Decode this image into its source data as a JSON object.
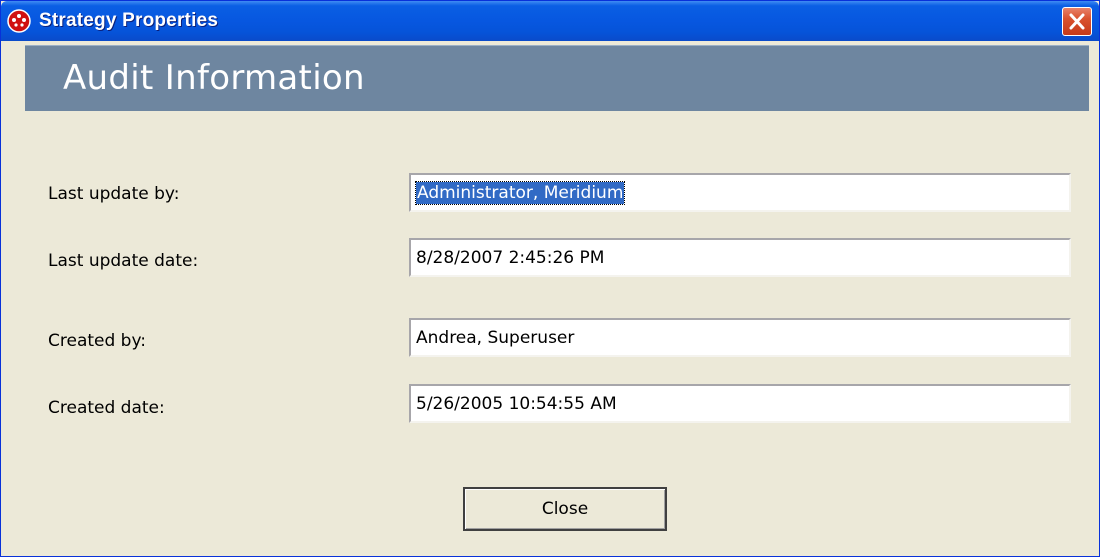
{
  "window": {
    "title": "Strategy Properties",
    "icon": "red-round-app-icon",
    "close_icon": "close-x-icon",
    "titlebar_color": "#0757E0",
    "close_color": "#D9522E"
  },
  "section": {
    "title": "Audit Information",
    "header_color": "#6E86A0"
  },
  "fields": {
    "last_update_by": {
      "label": "Last update by:",
      "value": "Administrator, Meridium",
      "selected": true
    },
    "last_update_date": {
      "label": "Last update date:",
      "value": "8/28/2007 2:45:26 PM"
    },
    "created_by": {
      "label": "Created by:",
      "value": "Andrea, Superuser"
    },
    "created_date": {
      "label": "Created date:",
      "value": "5/26/2005 10:54:55 AM"
    }
  },
  "buttons": {
    "close_label": "Close"
  }
}
